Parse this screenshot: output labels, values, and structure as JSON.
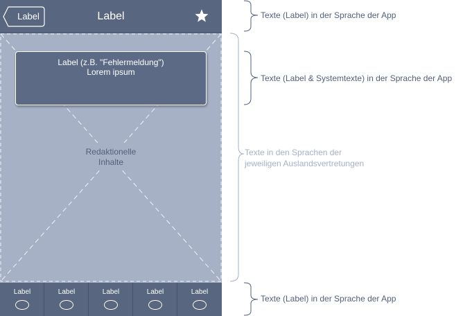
{
  "nav_bar": {
    "back_label": "Label",
    "title": "Label",
    "favorite_icon": "star-icon"
  },
  "alert": {
    "title": "Label (z.B. \"Fehlermeldung\")",
    "body": "Lorem ipsum"
  },
  "content": {
    "editorial_line1": "Redaktionelle",
    "editorial_line2": "Inhalte"
  },
  "tab_bar": {
    "items": [
      {
        "label": "Label",
        "icon": "circle-icon"
      },
      {
        "label": "Label",
        "icon": "circle-icon"
      },
      {
        "label": "Label",
        "icon": "circle-icon"
      },
      {
        "label": "Label",
        "icon": "circle-icon"
      },
      {
        "label": "Label",
        "icon": "circle-icon"
      }
    ]
  },
  "annotations": {
    "nav_note": "Texte (Label) in der Sprache der App",
    "alert_note": "Texte (Label & Systemtexte) in der Sprache der App",
    "content_note_line1": "Texte in den Sprachen der",
    "content_note_line2": "jeweiligen Auslandsvertretungen",
    "tab_note": "Texte (Label) in der Sprache der App"
  },
  "colors": {
    "bar_background": "#59667f",
    "content_background": "#a6b1c6",
    "alert_background": "#5c6a86",
    "annotation_text": "#515f7b",
    "annotation_light_text": "#a6b1c6"
  }
}
